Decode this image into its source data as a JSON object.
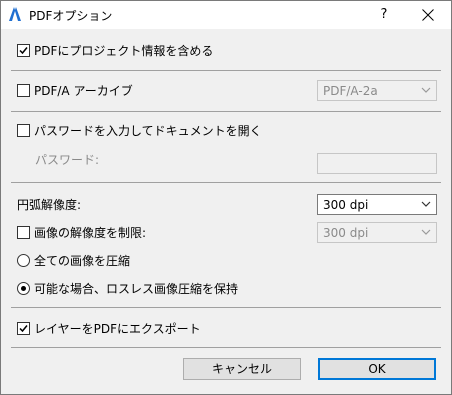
{
  "window": {
    "title": "PDFオプション",
    "help_label": "?"
  },
  "options": {
    "include_project_info": {
      "label": "PDFにプロジェクト情報を含める",
      "checked": true
    },
    "pdfa_archive": {
      "label": "PDF/A アーカイブ",
      "checked": false,
      "format_value": "PDF/A-2a"
    },
    "password_open": {
      "label": "パスワードを入力してドキュメントを開く",
      "checked": false,
      "password_label": "パスワード:",
      "password_value": ""
    },
    "arc_resolution": {
      "label": "円弧解像度:",
      "value": "300 dpi"
    },
    "limit_image_resolution": {
      "label": "画像の解像度を制限:",
      "checked": false,
      "value": "300 dpi"
    },
    "compress_all_images": {
      "label": "全ての画像を圧縮",
      "selected": false
    },
    "lossless_when_possible": {
      "label": "可能な場合、ロスレス画像圧縮を保持",
      "selected": true
    },
    "export_layers": {
      "label": "レイヤーをPDFにエクスポート",
      "checked": true
    }
  },
  "buttons": {
    "cancel": "キャンセル",
    "ok": "OK"
  },
  "colors": {
    "accent": "#0078d7",
    "dialog_bg": "#f0f0f0"
  }
}
